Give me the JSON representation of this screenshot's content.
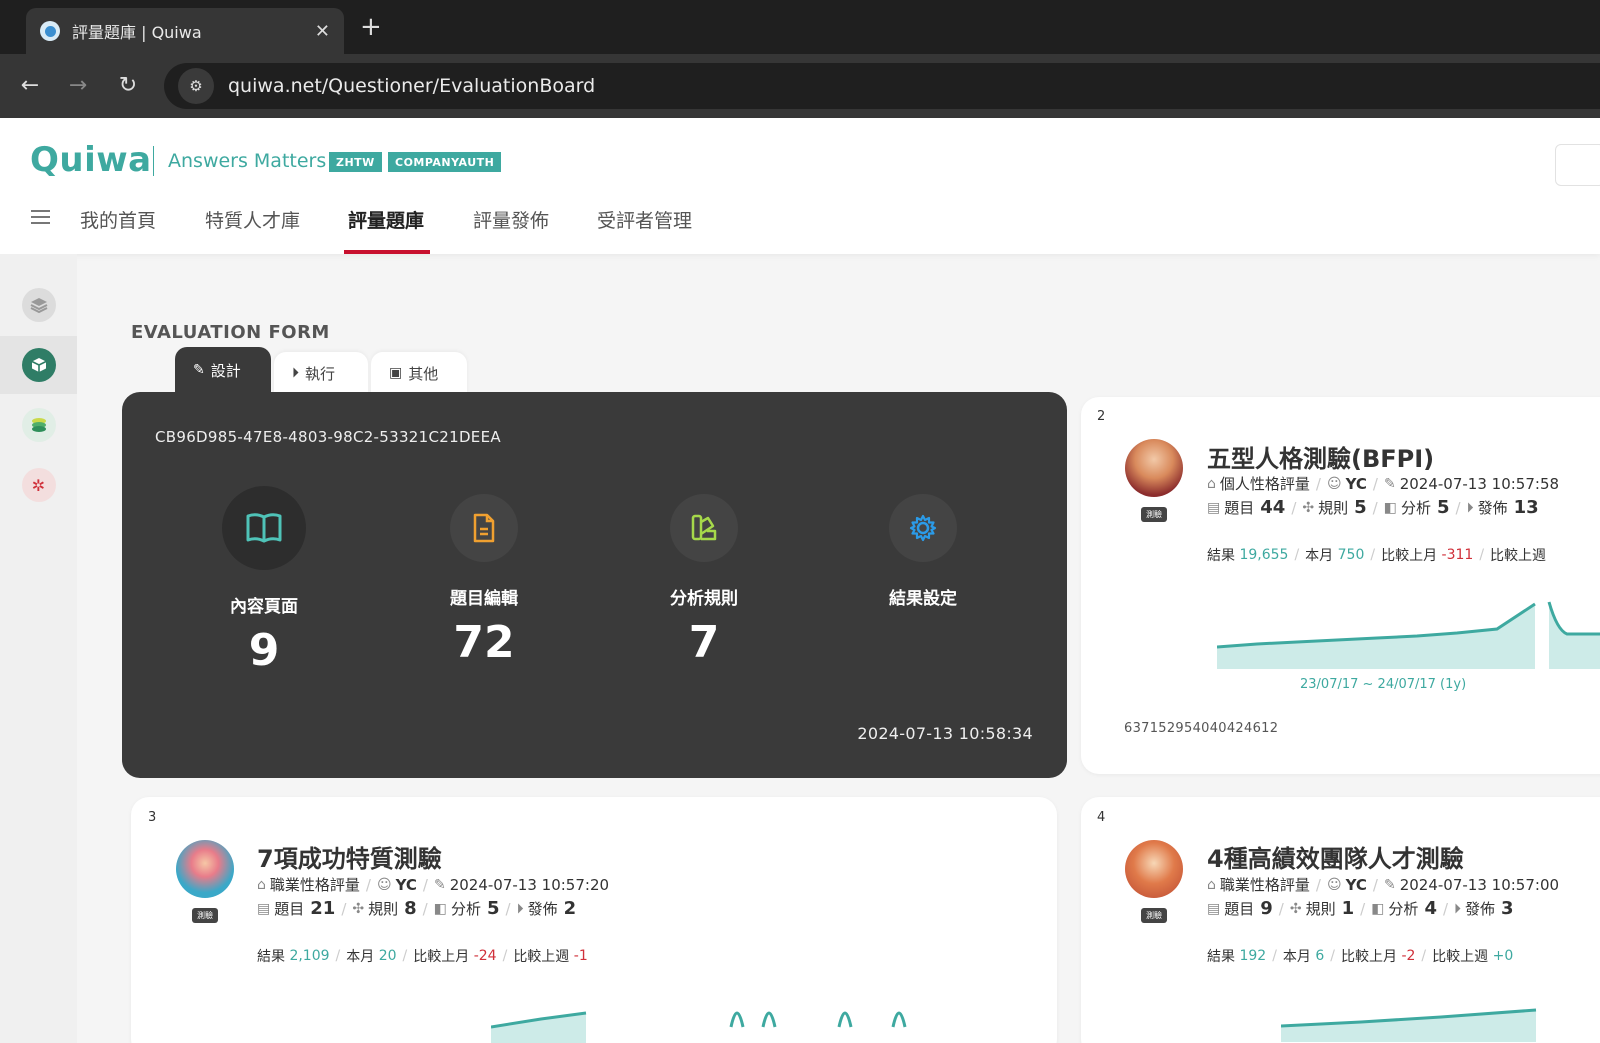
{
  "browser": {
    "tab_title": "評量題庫 | Quiwa",
    "url": "quiwa.net/Questioner/EvaluationBoard"
  },
  "header": {
    "logo": "Quiwa",
    "tagline": "Answers Matters",
    "badges": [
      "ZHTW",
      "COMPANYAUTH"
    ],
    "nav": [
      "我的首頁",
      "特質人才庫",
      "評量題庫",
      "評量發佈",
      "受評者管理"
    ],
    "active_nav": "評量題庫"
  },
  "section_title": "EVALUATION FORM",
  "form_tabs": [
    "設計",
    "執行",
    "其他"
  ],
  "active_card": {
    "guid": "CB96D985-47E8-4803-98C2-53321C21DEEA",
    "stats": [
      {
        "label": "內容頁面",
        "value": "9",
        "icon": "book-icon",
        "color": "#4fc3b8"
      },
      {
        "label": "題目編輯",
        "value": "72",
        "icon": "document-icon",
        "color": "#f0a030"
      },
      {
        "label": "分析規則",
        "value": "7",
        "icon": "palette-icon",
        "color": "#a6d94a"
      },
      {
        "label": "結果設定",
        "value": "",
        "icon": "gear-icon",
        "color": "#2b9be8"
      }
    ],
    "date": "2024-07-13 10:58:34"
  },
  "cards": [
    {
      "num": "2",
      "title": "五型人格測驗(BFPI)",
      "category": "個人性格評量",
      "author": "YC",
      "date": "2024-07-13 10:57:58",
      "questions": "44",
      "rules": "5",
      "analysis": "5",
      "publish": "13",
      "results": "19,655",
      "month": "750",
      "vs_month": "-311",
      "vs_week_label": "比較上週",
      "range": "23/07/17 ~ 24/07/17 (1y)",
      "id": "637152954040424612",
      "badge": "測驗"
    },
    {
      "num": "3",
      "title": "7項成功特質測驗",
      "category": "職業性格評量",
      "author": "YC",
      "date": "2024-07-13 10:57:20",
      "questions": "21",
      "rules": "8",
      "analysis": "5",
      "publish": "2",
      "results": "2,109",
      "month": "20",
      "vs_month": "-24",
      "vs_week": "-1",
      "badge": "測驗"
    },
    {
      "num": "4",
      "title": "4種高績效團隊人才測驗",
      "category": "職業性格評量",
      "author": "YC",
      "date": "2024-07-13 10:57:00",
      "questions": "9",
      "rules": "1",
      "analysis": "4",
      "publish": "3",
      "results": "192",
      "month": "6",
      "vs_month": "-2",
      "vs_week": "+0",
      "badge": "測驗"
    }
  ],
  "labels": {
    "questions": "題目",
    "rules": "規則",
    "analysis": "分析",
    "publish": "發佈",
    "results": "結果",
    "month": "本月",
    "vs_month": "比較上月",
    "vs_week": "比較上週"
  },
  "colors": {
    "brand": "#3ea9a0",
    "active_nav": "#c8102e",
    "dark_card": "#3a3a3a",
    "negative": "#d0303a"
  }
}
